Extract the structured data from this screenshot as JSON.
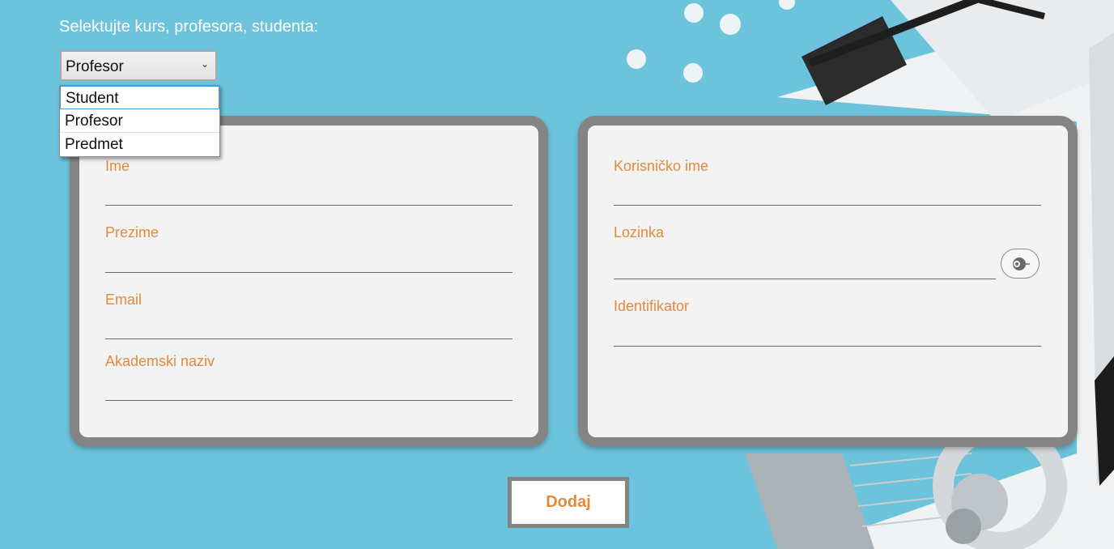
{
  "colors": {
    "background": "#6cc3dc",
    "label_orange": "#e38a3a",
    "card_border": "#848484",
    "card_bg": "#f3f3f3"
  },
  "prompt": "Selektujte kurs, profesora, studenta:",
  "select": {
    "value": "Profesor",
    "icon": "chevron-down-icon"
  },
  "dropdown": {
    "options": [
      "Student",
      "Profesor",
      "Predmet"
    ]
  },
  "left_form": {
    "ime": "Ime",
    "prezime": "Prezime",
    "email": "Email",
    "akademski_naziv": "Akademski naziv"
  },
  "right_form": {
    "korisnicko_ime": "Korisničko ime",
    "lozinka": "Lozinka",
    "identifikator": "Identifikator",
    "eye_icon": "eye-icon"
  },
  "add_button": "Dodaj"
}
